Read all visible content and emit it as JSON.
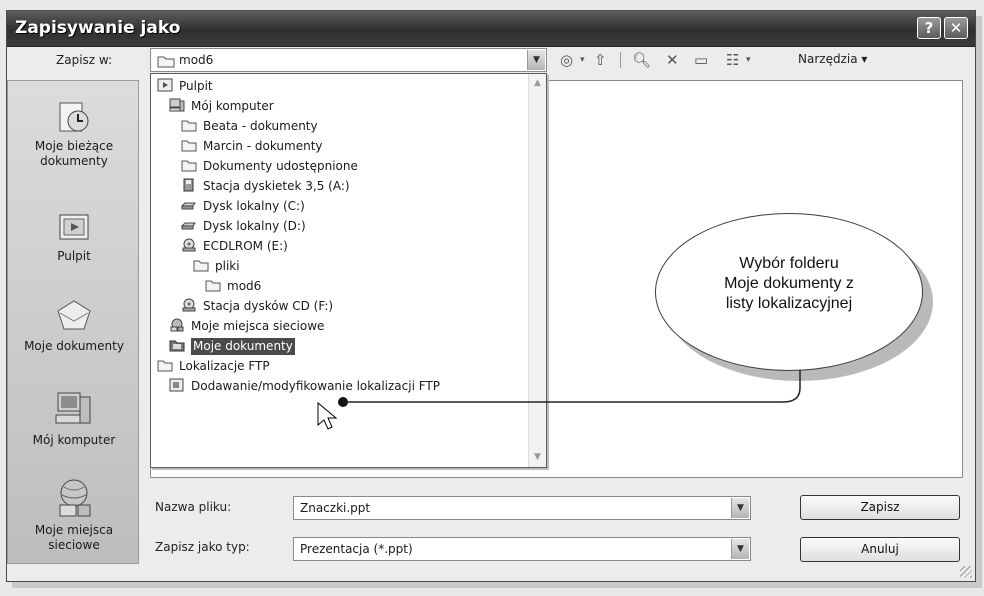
{
  "window": {
    "title": "Zapisywanie jako"
  },
  "titlebar": {
    "help_glyph": "?",
    "close_glyph": "✕"
  },
  "save_in": {
    "label": "Zapisz w:",
    "value": "mod6"
  },
  "toolbar": {
    "tools_label": "Narzędzia ▾"
  },
  "places": [
    {
      "label": "Moje bieżące dokumenty",
      "icon": "recent-documents-icon"
    },
    {
      "label": "Pulpit",
      "icon": "desktop-icon"
    },
    {
      "label": "Moje dokumenty",
      "icon": "my-documents-icon"
    },
    {
      "label": "Mój komputer",
      "icon": "my-computer-icon"
    },
    {
      "label": "Moje miejsca sieciowe",
      "icon": "network-places-icon"
    }
  ],
  "location_list": {
    "items": [
      {
        "label": "Pulpit",
        "icon": "desktop-icon",
        "level": 0
      },
      {
        "label": "Mój komputer",
        "icon": "computer-icon",
        "level": 1
      },
      {
        "label": "Beata - dokumenty",
        "icon": "folder-icon",
        "level": 2
      },
      {
        "label": "Marcin - dokumenty",
        "icon": "folder-icon",
        "level": 2
      },
      {
        "label": "Dokumenty udostępnione",
        "icon": "folder-icon",
        "level": 2
      },
      {
        "label": "Stacja dyskietek 3,5 (A:)",
        "icon": "floppy-icon",
        "level": 2
      },
      {
        "label": "Dysk lokalny (C:)",
        "icon": "drive-icon",
        "level": 2
      },
      {
        "label": "Dysk lokalny (D:)",
        "icon": "drive-icon",
        "level": 2
      },
      {
        "label": "ECDLROM (E:)",
        "icon": "cdrom-icon",
        "level": 2
      },
      {
        "label": "pliki",
        "icon": "folder-icon",
        "level": 3
      },
      {
        "label": "mod6",
        "icon": "folder-icon",
        "level": 4
      },
      {
        "label": "Stacja dysków CD (F:)",
        "icon": "cdrom-icon",
        "level": 2
      },
      {
        "label": "Moje miejsca sieciowe",
        "icon": "network-icon",
        "level": 1
      },
      {
        "label": "Moje dokumenty",
        "icon": "documents-folder-icon",
        "level": 1,
        "selected": true
      },
      {
        "label": "Lokalizacje FTP",
        "icon": "folder-icon",
        "level": 0
      },
      {
        "label": "Dodawanie/modyfikowanie lokalizacji FTP",
        "icon": "ftp-icon",
        "level": 1
      }
    ]
  },
  "callout": {
    "line1": "Wybór folderu",
    "line2": "Moje dokumenty z",
    "line3": "listy lokalizacyjnej"
  },
  "file_name": {
    "label": "Nazwa pliku:",
    "value": "Znaczki.ppt"
  },
  "file_type": {
    "label": "Zapisz jako typ:",
    "value": "Prezentacja (*.ppt)"
  },
  "buttons": {
    "save": "Zapisz",
    "cancel": "Anuluj"
  }
}
